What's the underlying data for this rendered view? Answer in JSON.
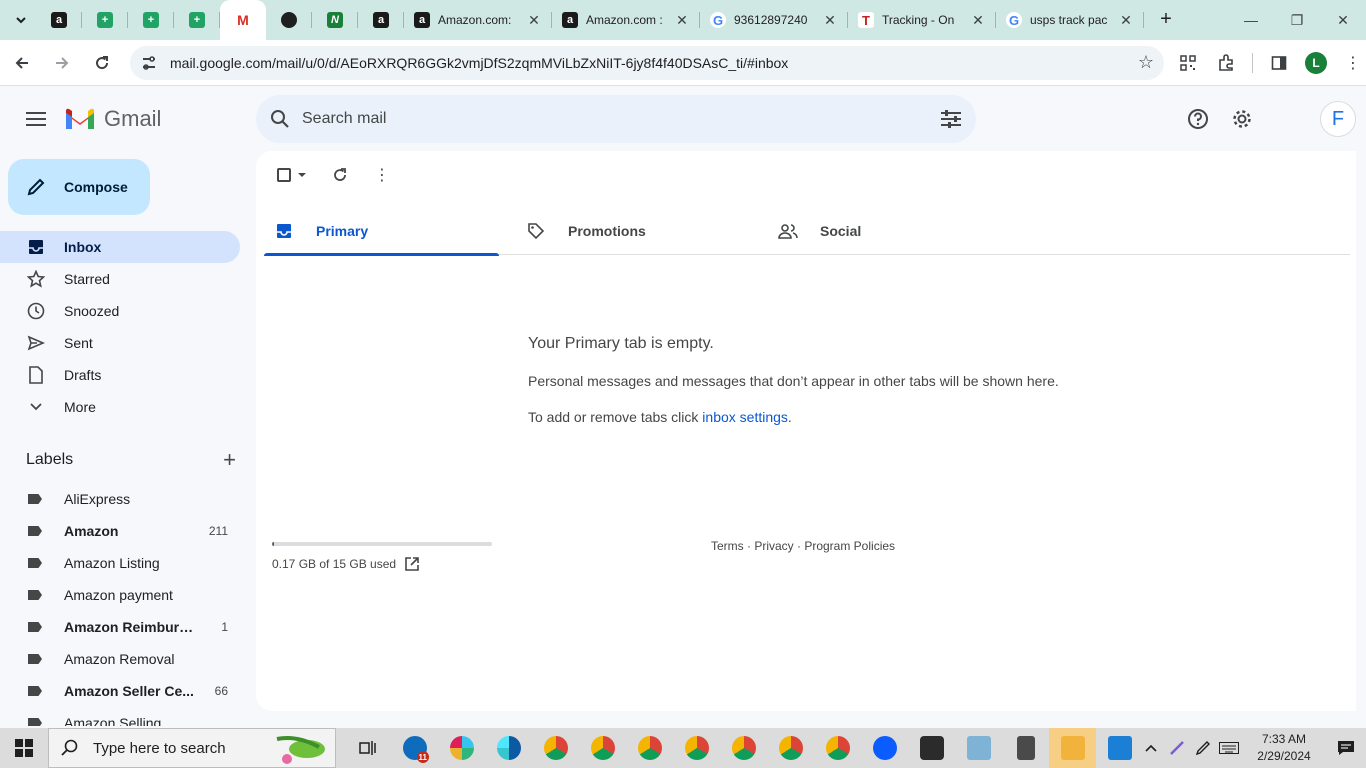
{
  "browser": {
    "tabs": [
      {
        "title": "Amazon.com:",
        "icon": "amazon-icon"
      },
      {
        "title": "Amazon.com :",
        "icon": "amazon-icon"
      },
      {
        "title": "93612897240",
        "icon": "google-icon"
      },
      {
        "title": "Tracking - On",
        "icon": "ontrac-icon"
      },
      {
        "title": "usps track pac",
        "icon": "google-icon"
      }
    ],
    "url": "mail.google.com/mail/u/0/d/AEoRXRQR6GGk2vmjDfS2zqmMViLbZxNiIT-6jy8f4f40DSAsC_ti/#inbox",
    "profile_initial": "L"
  },
  "gmail": {
    "app_name": "Gmail",
    "search_placeholder": "Search mail",
    "avatar_initial": "F",
    "compose_label": "Compose",
    "nav": [
      {
        "label": "Inbox",
        "icon": "inbox-icon",
        "active": true
      },
      {
        "label": "Starred",
        "icon": "star-icon"
      },
      {
        "label": "Snoozed",
        "icon": "clock-icon"
      },
      {
        "label": "Sent",
        "icon": "send-icon"
      },
      {
        "label": "Drafts",
        "icon": "draft-icon"
      },
      {
        "label": "More",
        "icon": "chevron-down-icon"
      }
    ],
    "labels_title": "Labels",
    "labels": [
      {
        "name": "AliExpress",
        "count": "",
        "bold": false
      },
      {
        "name": "Amazon",
        "count": "211",
        "bold": true
      },
      {
        "name": "Amazon Listing",
        "count": "",
        "bold": false
      },
      {
        "name": "Amazon payment",
        "count": "",
        "bold": false
      },
      {
        "name": "Amazon Reimburse...",
        "count": "1",
        "bold": true
      },
      {
        "name": "Amazon Removal",
        "count": "",
        "bold": false
      },
      {
        "name": "Amazon Seller Ce...",
        "count": "66",
        "bold": true
      },
      {
        "name": "Amazon Selling",
        "count": "",
        "bold": false
      }
    ],
    "tabs": [
      {
        "label": "Primary",
        "active": true
      },
      {
        "label": "Promotions",
        "active": false
      },
      {
        "label": "Social",
        "active": false
      }
    ],
    "empty_title": "Your Primary tab is empty.",
    "empty_desc": "Personal messages and messages that don’t appear in other tabs will be shown here.",
    "empty_settings_prefix": "To add or remove tabs click ",
    "empty_settings_link": "inbox settings",
    "empty_settings_suffix": ".",
    "storage_text": "0.17 GB of 15 GB used",
    "storage_fraction": 0.011,
    "footer": "Terms · Privacy · Program Policies"
  },
  "taskbar": {
    "search_placeholder": "Type here to search",
    "time": "7:33 AM",
    "date": "2/29/2024",
    "mail_badge": "11"
  },
  "colors": {
    "tabstrip": "#cfe8e4",
    "compose": "#c2e7ff",
    "active_nav": "#d3e3fd",
    "accent": "#0b57d0"
  }
}
